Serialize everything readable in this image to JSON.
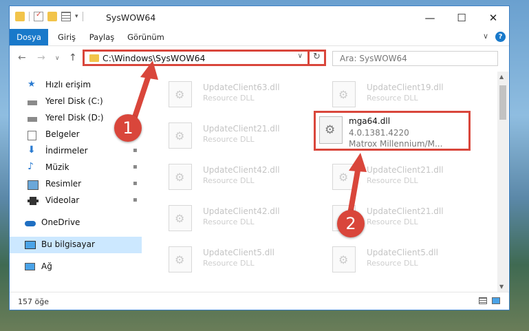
{
  "window": {
    "title": "SysWOW64",
    "minimize": "—",
    "maximize": "☐",
    "close": "✕"
  },
  "ribbon": {
    "tabs": [
      "Dosya",
      "Giriş",
      "Paylaş",
      "Görünüm"
    ],
    "expand": "∨",
    "help": "?"
  },
  "nav": {
    "back": "←",
    "forward": "→",
    "recent": "∨",
    "up": "↑",
    "address": "C:\\Windows\\SysWOW64",
    "address_dropdown": "∨",
    "refresh": "↻",
    "search_placeholder": "Ara: SysWOW64"
  },
  "sidebar": {
    "items": [
      {
        "label": "Hızlı erişim",
        "icon": "star-icon",
        "pinned": false
      },
      {
        "label": "Yerel Disk (C:)",
        "icon": "drive-icon",
        "pinned": false
      },
      {
        "label": "Yerel Disk (D:)",
        "icon": "drive-icon",
        "pinned": false
      },
      {
        "label": "Belgeler",
        "icon": "documents-icon",
        "pinned": false
      },
      {
        "label": "İndirmeler",
        "icon": "download-icon",
        "pinned": true
      },
      {
        "label": "Müzik",
        "icon": "music-icon",
        "pinned": true
      },
      {
        "label": "Resimler",
        "icon": "pictures-icon",
        "pinned": true
      },
      {
        "label": "Videolar",
        "icon": "video-icon",
        "pinned": true
      },
      {
        "label": "OneDrive",
        "icon": "cloud-icon",
        "pinned": false
      },
      {
        "label": "Bu bilgisayar",
        "icon": "computer-icon",
        "pinned": false,
        "selected": true
      },
      {
        "label": "Ağ",
        "icon": "network-icon",
        "pinned": false
      }
    ],
    "pin_glyph": "📌"
  },
  "files": {
    "left": [
      {
        "name": "UpdateClient63.dll",
        "desc": "Resource DLL"
      },
      {
        "name": "UpdateClient21.dll",
        "desc": "Resource DLL"
      },
      {
        "name": "UpdateClient42.dll",
        "desc": "Resource DLL"
      },
      {
        "name": "UpdateClient42.dll",
        "desc": "Resource DLL"
      },
      {
        "name": "UpdateClient5.dll",
        "desc": "Resource DLL"
      }
    ],
    "right": [
      {
        "name": "UpdateClient19.dll",
        "desc": "Resource DLL"
      },
      {
        "name": "UpdateClient21.dll",
        "desc": "Resource DLL"
      },
      {
        "name": "UpdateClient21.dll",
        "desc": "Resource DLL"
      },
      {
        "name": "UpdateClient5.dll",
        "desc": "Resource DLL"
      }
    ],
    "highlighted": {
      "name": "mga64.dll",
      "version": "4.0.1381.4220",
      "description": "Matrox Millennium/M..."
    }
  },
  "status": {
    "count": "157 öğe"
  },
  "annotations": {
    "step1": "1",
    "step2": "2",
    "color": "#d9463b"
  },
  "colors": {
    "accent": "#1979ca",
    "highlight": "#d9463b",
    "selected": "#cce8ff"
  }
}
